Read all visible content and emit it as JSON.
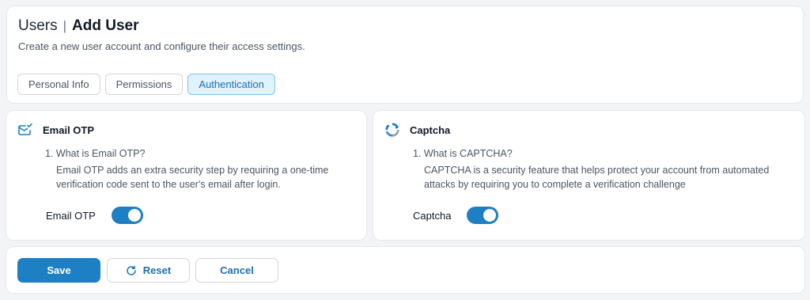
{
  "header": {
    "breadcrumb_parent": "Users",
    "breadcrumb_separator": "|",
    "breadcrumb_current": "Add User",
    "subtitle": "Create a new user account and configure their access settings."
  },
  "tabs": [
    {
      "label": "Personal Info",
      "active": false
    },
    {
      "label": "Permissions",
      "active": false
    },
    {
      "label": "Authentication",
      "active": true
    }
  ],
  "email_otp": {
    "icon": "mail-check-icon",
    "title": "Email OTP",
    "question": "1. What is Email OTP?",
    "answer": "Email OTP adds an extra security step by requiring a one-time verification code sent to the user's email after login.",
    "toggle_label": "Email OTP",
    "enabled": true
  },
  "captcha": {
    "icon": "recaptcha-icon",
    "title": "Captcha",
    "question": "1. What is CAPTCHA?",
    "answer": "CAPTCHA is a security feature that helps protect your account from automated attacks by requiring you to complete a verification challenge",
    "toggle_label": "Captcha",
    "enabled": true
  },
  "footer": {
    "save_label": "Save",
    "reset_label": "Reset",
    "cancel_label": "Cancel"
  },
  "colors": {
    "accent": "#1d7fc4",
    "tab_active_bg": "#e0f2fe",
    "page_bg": "#f3f4f6"
  }
}
